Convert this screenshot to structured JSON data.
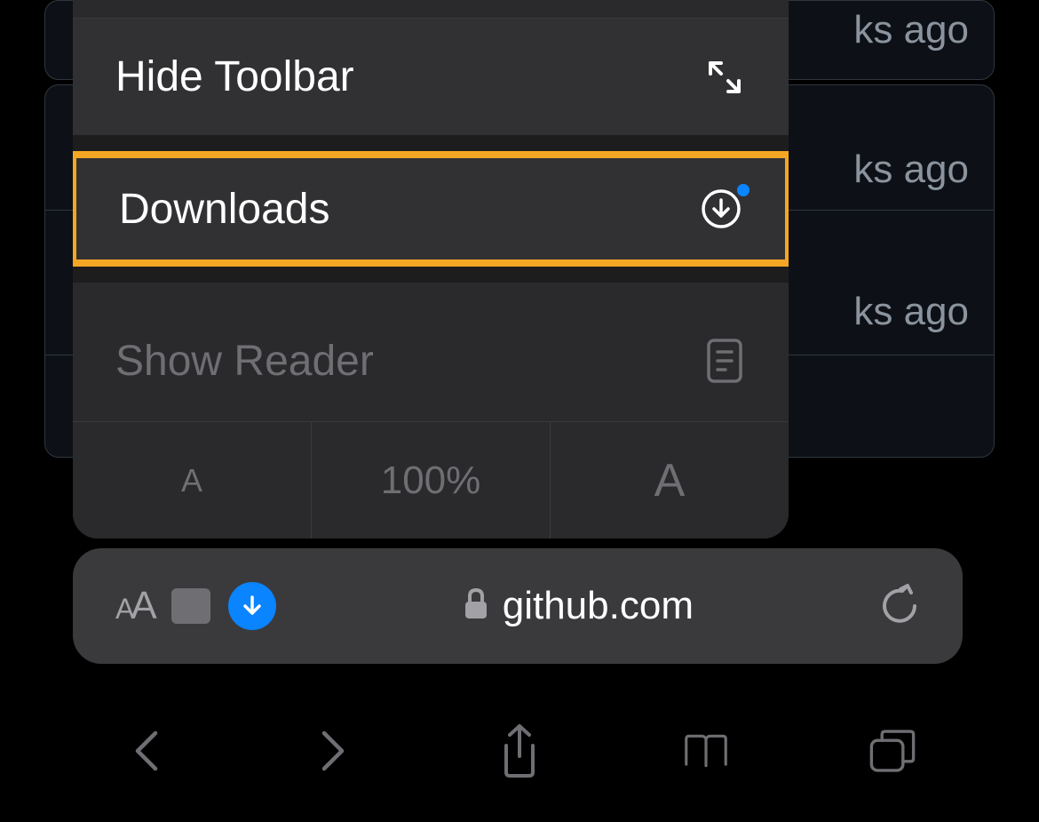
{
  "menu": {
    "hide_toolbar": "Hide Toolbar",
    "downloads": "Downloads",
    "show_reader": "Show Reader",
    "zoom": {
      "small": "A",
      "percent": "100%",
      "large": "A"
    }
  },
  "address_bar": {
    "url": "github.com"
  },
  "background": {
    "row1": "ks ago",
    "row2": "ks ago",
    "row3": "ks ago"
  }
}
